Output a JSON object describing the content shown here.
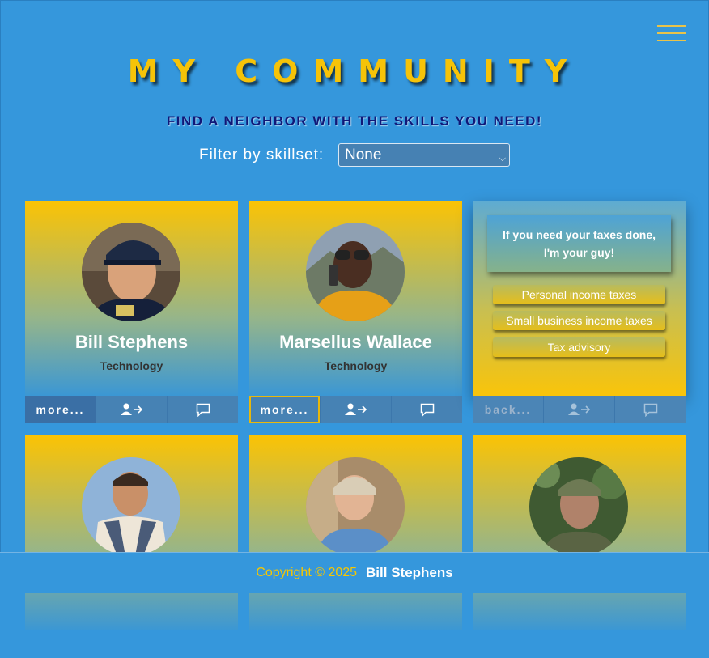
{
  "menu": {
    "icon": "hamburger-icon"
  },
  "header": {
    "title": "MY COMMUNITY",
    "subtitle": "FIND A NEIGHBOR WITH THE SKILLS YOU NEED!"
  },
  "filter": {
    "label": "Filter by skillset:",
    "selected": "None"
  },
  "cards": [
    {
      "name": "Bill Stephens",
      "skill": "Technology",
      "more_label": "more..."
    },
    {
      "name": "Marsellus Wallace",
      "skill": "Technology",
      "more_label": "more..."
    },
    {
      "back_label": "back...",
      "bio": "If you need your taxes done, I'm your guy!",
      "skills": [
        "Personal income taxes",
        "Small business income taxes",
        "Tax advisory"
      ]
    },
    {},
    {},
    {}
  ],
  "footer": {
    "copyright": "Copyright © 2025",
    "owner": "Bill Stephens"
  },
  "colors": {
    "background": "#3597dc",
    "accent": "#f6c308",
    "bar": "#4682b4"
  }
}
